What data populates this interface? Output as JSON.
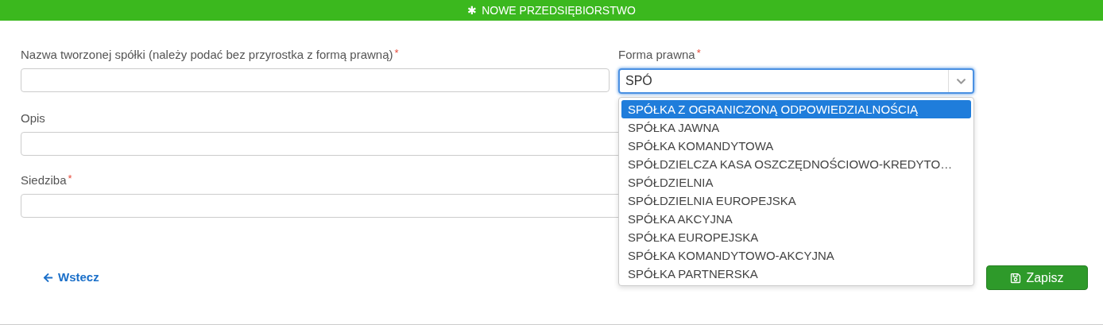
{
  "header": {
    "icon": "✱",
    "title": "NOWE PRZEDSIĘBIORSTWO"
  },
  "fields": [
    {
      "label": "Nazwa tworzonej spółki (należy podać bez przyrostka z formą prawną)",
      "required_mark": "*"
    },
    {
      "label": "Opis"
    },
    {
      "label": "Siedziba",
      "required_mark": "*"
    }
  ],
  "legal_form": {
    "label": "Forma prawna",
    "required_mark": "*",
    "value": "SPÓ",
    "expanded": true,
    "options": [
      {
        "label": "SPÓŁKA Z OGRANICZONĄ ODPOWIEDZIALNOŚCIĄ",
        "selected": true
      },
      {
        "label": "SPÓŁKA JAWNA",
        "selected": false
      },
      {
        "label": "SPÓŁKA KOMANDYTOWA",
        "selected": false
      },
      {
        "label": "SPÓŁDZIELCZA KASA OSZCZĘDNOŚCIOWO-KREDYTO…",
        "selected": false
      },
      {
        "label": "SPÓŁDZIELNIA",
        "selected": false
      },
      {
        "label": "SPÓŁDZIELNIA EUROPEJSKA",
        "selected": false
      },
      {
        "label": "SPÓŁKA AKCYJNA",
        "selected": false
      },
      {
        "label": "SPÓŁKA EUROPEJSKA",
        "selected": false
      },
      {
        "label": "SPÓŁKA KOMANDYTOWO-AKCYJNA",
        "selected": false
      },
      {
        "label": "SPÓŁKA PARTNERSKA",
        "selected": false
      }
    ]
  },
  "back_link": "Wstecz",
  "save_button": "Zapisz"
}
